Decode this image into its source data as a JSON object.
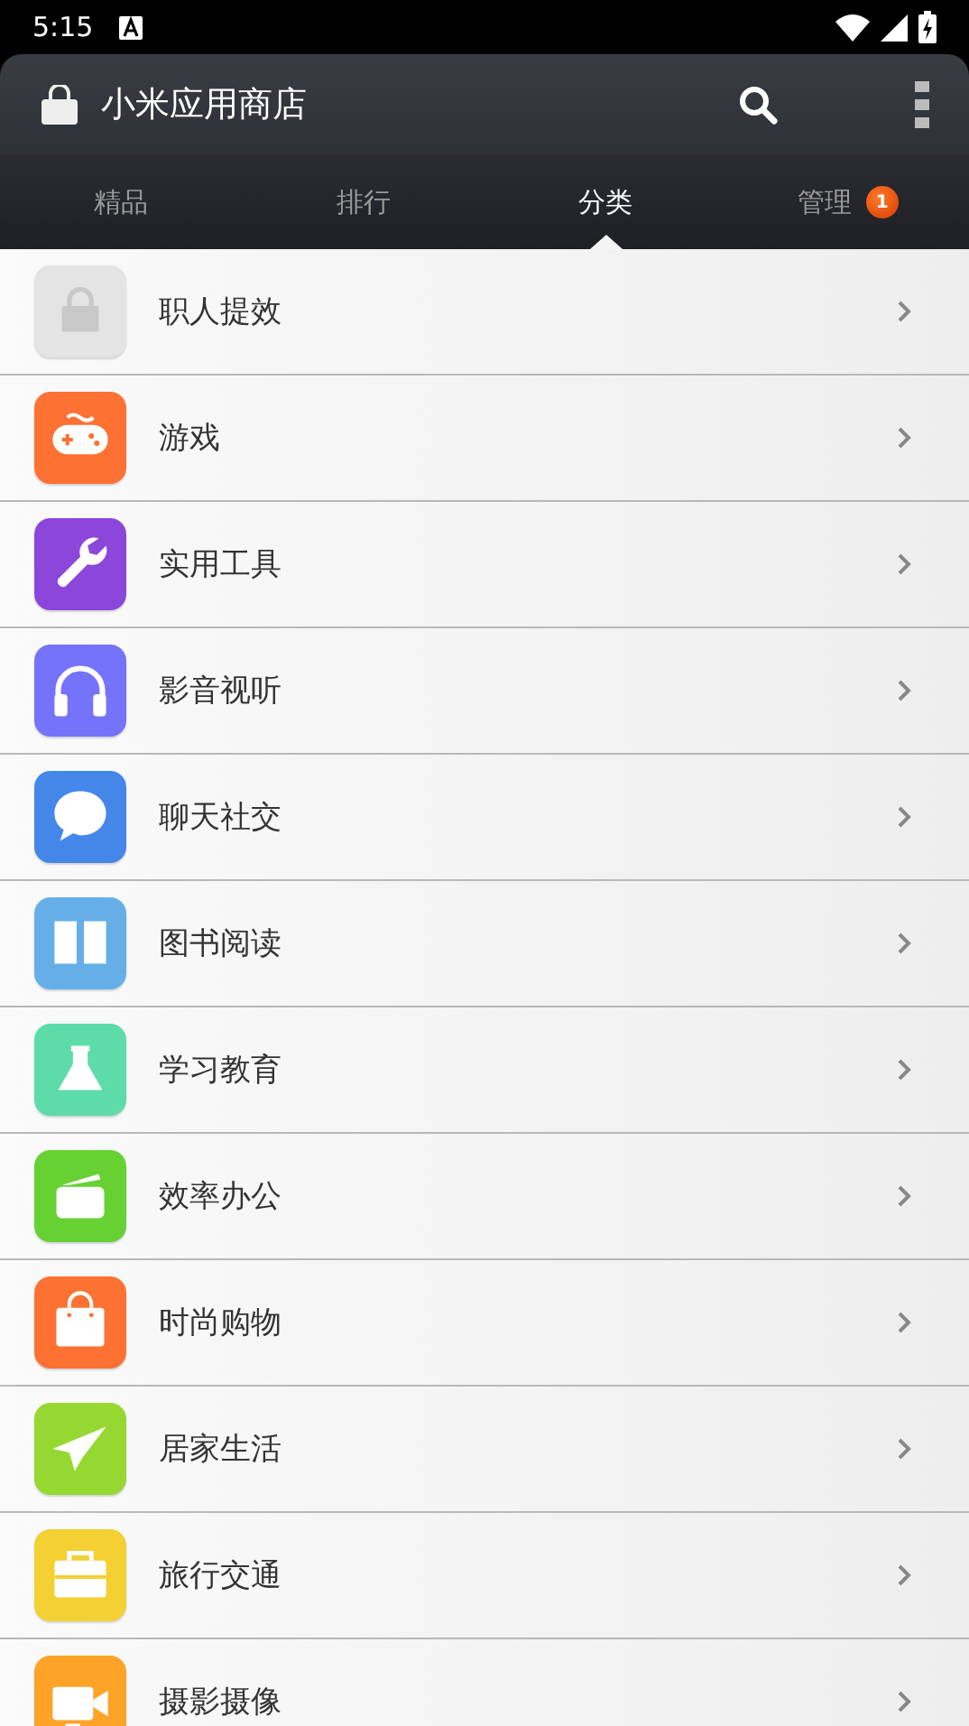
{
  "status_bar": {
    "time": "5:15"
  },
  "app_bar": {
    "title": "小米应用商店"
  },
  "tabs": [
    {
      "label": "精品",
      "selected": false
    },
    {
      "label": "排行",
      "selected": false
    },
    {
      "label": "分类",
      "selected": true
    },
    {
      "label": "管理",
      "selected": false,
      "badge": "1"
    }
  ],
  "categories": [
    {
      "label": "职人提效",
      "kind": "bag",
      "color": "#e4e4e4"
    },
    {
      "label": "游戏",
      "kind": "gamepad",
      "color": "#fd7232"
    },
    {
      "label": "实用工具",
      "kind": "wrench",
      "color": "#8c47da"
    },
    {
      "label": "影音视听",
      "kind": "headphones",
      "color": "#7673fb"
    },
    {
      "label": "聊天社交",
      "kind": "chat",
      "color": "#4487e8"
    },
    {
      "label": "图书阅读",
      "kind": "book",
      "color": "#65aee8"
    },
    {
      "label": "学习教育",
      "kind": "flask",
      "color": "#5ddcaa"
    },
    {
      "label": "效率办公",
      "kind": "wallet",
      "color": "#67d032"
    },
    {
      "label": "时尚购物",
      "kind": "shopping",
      "color": "#fd7232"
    },
    {
      "label": "居家生活",
      "kind": "plane",
      "color": "#95d832"
    },
    {
      "label": "旅行交通",
      "kind": "suitcase",
      "color": "#f4d032"
    },
    {
      "label": "摄影摄像",
      "kind": "camera",
      "color": "#fda428"
    }
  ]
}
